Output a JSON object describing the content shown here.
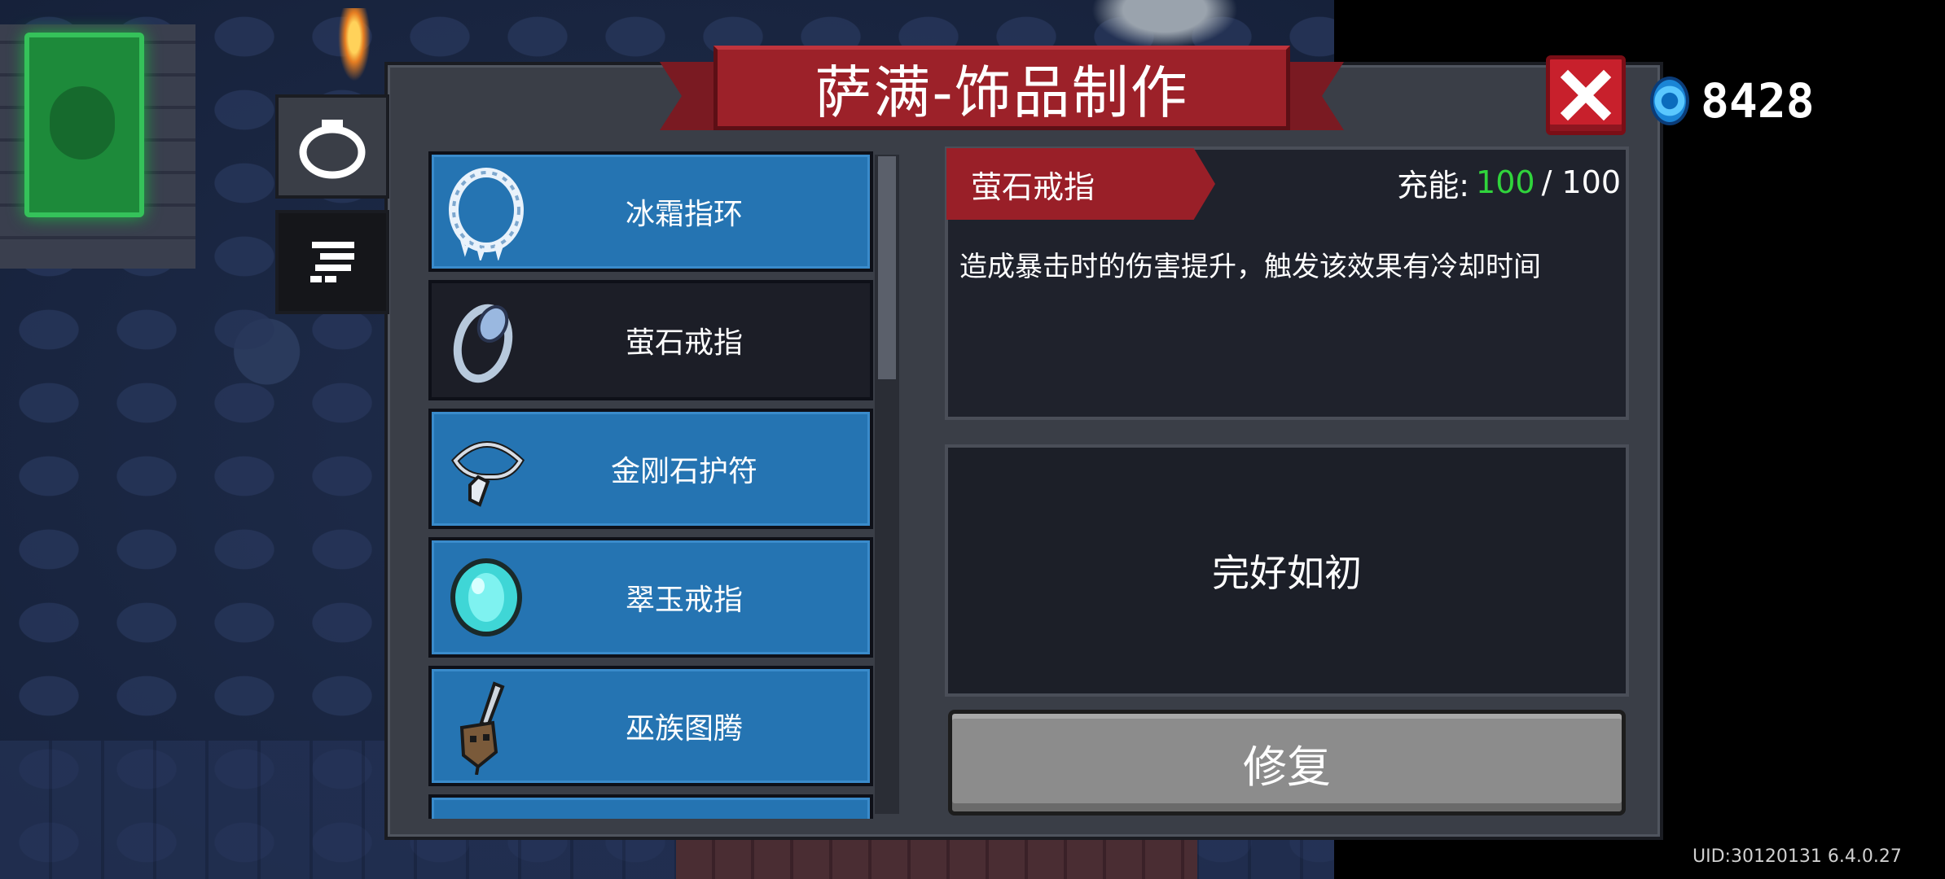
{
  "header": {
    "title": "萨满-饰品制作",
    "close_icon": "close-icon"
  },
  "currency": {
    "icon": "blue-gem-icon",
    "amount": "8428"
  },
  "tabs": [
    {
      "name": "accessory-tab",
      "icon": "ring-icon",
      "selected": true
    },
    {
      "name": "materials-tab",
      "icon": "filter-icon",
      "selected": false
    }
  ],
  "item_list": {
    "items": [
      {
        "label": "冰霜指环",
        "icon": "frost-ring-icon",
        "style": "blue"
      },
      {
        "label": "萤石戒指",
        "icon": "fluorite-ring-icon",
        "style": "dark",
        "selected": true
      },
      {
        "label": "金刚石护符",
        "icon": "diamond-amulet-icon",
        "style": "blue"
      },
      {
        "label": "翠玉戒指",
        "icon": "jade-ring-icon",
        "style": "blue"
      },
      {
        "label": "巫族图腾",
        "icon": "witch-totem-icon",
        "style": "blue"
      }
    ]
  },
  "detail": {
    "name": "萤石戒指",
    "charge_label": "充能:",
    "charge_current": "100",
    "charge_max": "/ 100",
    "description": "造成暴击时的伤害提升，触发该效果有冷却时间",
    "status": "完好如初",
    "repair_label": "修复"
  },
  "footer": {
    "uid": "UID:30120131 6.4.0.27"
  },
  "colors": {
    "accent_red": "#9c2129",
    "item_blue": "#2574b2",
    "charge_green": "#30d43c"
  }
}
